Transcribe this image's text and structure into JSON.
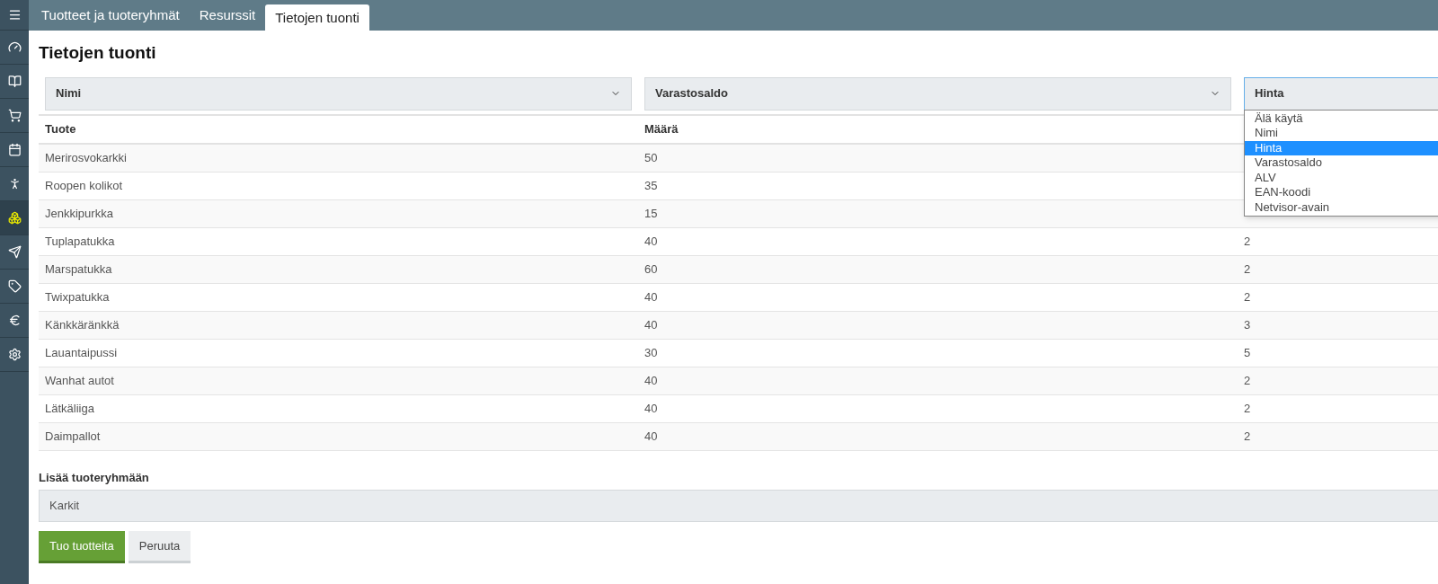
{
  "sidebar": {
    "items": [
      {
        "selected": false
      },
      {
        "selected": false
      },
      {
        "selected": false
      },
      {
        "selected": false
      },
      {
        "selected": false
      },
      {
        "selected": true
      },
      {
        "selected": false
      },
      {
        "selected": false
      },
      {
        "selected": false
      },
      {
        "selected": false
      }
    ]
  },
  "tabs": [
    {
      "label": "Tuotteet ja tuoteryhmät",
      "selected": false
    },
    {
      "label": "Resurssit",
      "selected": false
    },
    {
      "label": "Tietojen tuonti",
      "selected": true
    }
  ],
  "title": "Tietojen tuonti",
  "column_selects": [
    {
      "value": "Nimi",
      "open": false
    },
    {
      "value": "Varastosaldo",
      "open": false
    },
    {
      "value": "Hinta",
      "open": true
    }
  ],
  "dropdown_options": [
    {
      "label": "Älä käytä",
      "selected": false
    },
    {
      "label": "Nimi",
      "selected": false
    },
    {
      "label": "Hinta",
      "selected": true
    },
    {
      "label": "Varastosaldo",
      "selected": false
    },
    {
      "label": "ALV",
      "selected": false
    },
    {
      "label": "EAN-koodi",
      "selected": false
    },
    {
      "label": "Netvisor-avain",
      "selected": false
    }
  ],
  "table": {
    "columns": [
      "Tuote",
      "Määrä"
    ],
    "rows": [
      {
        "cells": [
          "Merirosvokarkki",
          "50"
        ]
      },
      {
        "cells": [
          "Roopen kolikot",
          "35"
        ]
      },
      {
        "cells": [
          "Jenkkipurkka",
          "15"
        ]
      },
      {
        "cells": [
          "Tuplapatukka",
          "40",
          "2"
        ]
      },
      {
        "cells": [
          "Marspatukka",
          "60",
          "2"
        ]
      },
      {
        "cells": [
          "Twixpatukka",
          "40",
          "2"
        ]
      },
      {
        "cells": [
          "Känkkäränkkä",
          "40",
          "3"
        ]
      },
      {
        "cells": [
          "Lauantaipussi",
          "30",
          "5"
        ]
      },
      {
        "cells": [
          "Wanhat autot",
          "40",
          "2"
        ]
      },
      {
        "cells": [
          "Lätkäliiga",
          "40",
          "2"
        ]
      },
      {
        "cells": [
          "Daimpallot",
          "40",
          "2"
        ]
      }
    ]
  },
  "product_group": {
    "label": "Lisää tuoteryhmään",
    "value": "Karkit"
  },
  "buttons": [
    {
      "label": "Tuo tuotteita",
      "kind": "primary"
    },
    {
      "label": "Peruuta",
      "kind": "secondary"
    }
  ]
}
